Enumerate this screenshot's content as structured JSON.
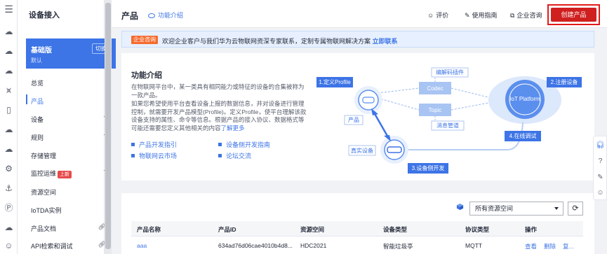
{
  "sidebar": {
    "title": "设备接入",
    "edition": {
      "name": "基础版",
      "sub": "默认",
      "switch_label": "切换"
    },
    "items": [
      {
        "label": "总览"
      },
      {
        "label": "产品"
      },
      {
        "label": "设备"
      },
      {
        "label": "规则"
      },
      {
        "label": "存储管理"
      },
      {
        "label": "监控运维",
        "badge": "上新"
      },
      {
        "label": "资源空间"
      },
      {
        "label": "IoTDA实例"
      },
      {
        "label": "产品文档"
      },
      {
        "label": "API检索和调试"
      }
    ]
  },
  "topbar": {
    "title": "产品",
    "intro_link": "功能介绍",
    "rate": "评价",
    "guide": "使用指南",
    "consult": "企业咨询",
    "create_button": "创建产品"
  },
  "banner": {
    "tag": "企业咨询",
    "message": "欢迎企业客户与我们华为云物联网资深专家联系，定制专属物联网解决方案",
    "link": "立即联系"
  },
  "intro_card": {
    "title": "功能介绍",
    "para1": "在物联网平台中，某一类具有相同能力或特征的设备的合集被称为一款产品。",
    "para2": "如果您希望使用平台查看设备上报的数据信息，并对设备进行管理控制，就需要开发产品模型(Profile)。定义Profile，使平台理解该款设备支持的属性、命令等信息。根据产品的接入协议、数据格式等可能还需要您定义其他相关的内容",
    "learn_more": "了解更多",
    "links": [
      "产品开发指引",
      "设备侧开发指南",
      "物联网云市场",
      "论坛交流"
    ]
  },
  "diagram": {
    "step1": "1.定义Profile",
    "step2": "2.注册设备",
    "step3": "3.设备侧开发",
    "step4": "4.在线调试",
    "codec_plugin": "编解码插件",
    "codec": "Codec",
    "topic": "Topic",
    "msg_pipe": "消息管道",
    "product": "产品",
    "real_device": "真实设备",
    "platform": "IoT Platform",
    "colors": {
      "step_bg": "#3d74e6",
      "light": "#dce8fb",
      "platform": "#5b8fee"
    }
  },
  "table": {
    "resource_space": "所有资源空间",
    "columns": [
      "产品名称",
      "产品ID",
      "资源空间",
      "设备类型",
      "协议类型",
      "操作"
    ],
    "rows": [
      {
        "name": "aaa",
        "id": "634ad76d06cae4010b4d8...",
        "space": "HDC2021",
        "type": "智能垃圾亭",
        "protocol": "MQTT",
        "actions": [
          "查看",
          "删除",
          "复..."
        ]
      }
    ]
  },
  "icons": {
    "rail": [
      "menu-icon",
      "cloud-icon",
      "cloud-icon",
      "cloud-icon",
      "chart-icon",
      "doc-icon",
      "cloud-icon",
      "cloud-icon",
      "gear-icon",
      "anchor-icon",
      "p-icon",
      "cloud-icon",
      "person-icon"
    ],
    "float": [
      "headset-icon",
      "help-icon",
      "edit-icon",
      "smile-icon"
    ]
  }
}
